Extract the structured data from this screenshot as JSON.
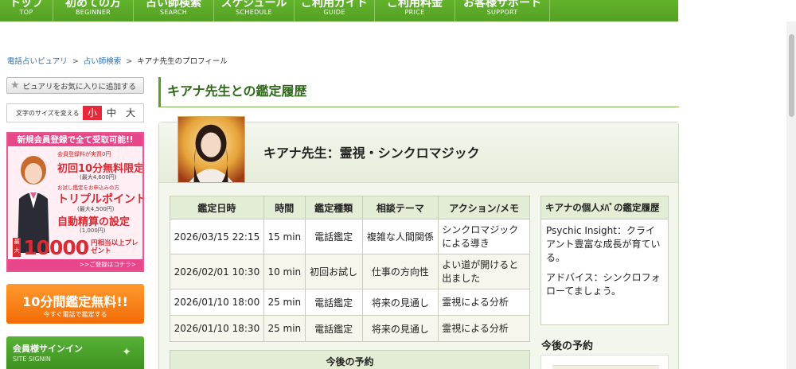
{
  "nav": {
    "items": [
      {
        "jp": "トップ",
        "en": "TOP"
      },
      {
        "jp": "初めての方",
        "en": "BEGINNER"
      },
      {
        "jp": "占い師検索",
        "en": "SEARCH"
      },
      {
        "jp": "スケジュール",
        "en": "SCHEDULE"
      },
      {
        "jp": "ご利用ガイド",
        "en": "GUIDE"
      },
      {
        "jp": "ご利用料金",
        "en": "PRICE"
      },
      {
        "jp": "お客様サポート",
        "en": "SUPPORT"
      }
    ]
  },
  "breadcrumb": {
    "home": "電話占いピュアリ",
    "search": "占い師検索",
    "current": "キアナ先生のプロフィール"
  },
  "sidebar": {
    "favorite_label": "ピュアリをお気に入りに追加する",
    "fontsize": {
      "label": "文字のサイズを変える",
      "small": "小",
      "medium": "中",
      "large": "大"
    },
    "banner_signup": {
      "header": "新規会員登録で全て受取可能!!",
      "line1": "会員登録料が実質0円",
      "line2": "初回10分無料限定",
      "line3": "(最大4,600円)",
      "line4": "お試し鑑定をお申込みの方",
      "line5": "トリプルポイント",
      "line6": "(最大4,500円)",
      "line7": "自動精算の設定",
      "line8": "(1,000円)",
      "tag": "最大",
      "big_number": "10000",
      "big_unit": "円相当以上プレゼント",
      "footer": ">>ご登録はコチラ>"
    },
    "banner_free": {
      "title": "10分間鑑定無料!!",
      "subtitle": "今すぐ電話で鑑定する"
    },
    "signin": {
      "title": "会員様サインイン",
      "subtitle": "SITE SIGNIN"
    }
  },
  "main": {
    "title": "キアナ先生との鑑定履歴",
    "profile_name": "キアナ先生：霊視・シンクロマジック",
    "table": {
      "headers": [
        "鑑定日時",
        "時間",
        "鑑定種類",
        "相談テーマ",
        "アクション/メモ"
      ],
      "rows": [
        {
          "date": "2026/03/15 22:15",
          "duration": "15 min",
          "type": "電話鑑定",
          "theme": "複雑な人間関係",
          "memo": "シンクロマジックによる導き"
        },
        {
          "date": "2026/02/01 10:30",
          "duration": "10 min",
          "type": "初回お試し",
          "theme": "仕事の方向性",
          "memo": "よい道が開けると出ました"
        },
        {
          "date": "2026/01/10 18:00",
          "duration": "25 min",
          "type": "電話鑑定",
          "theme": "将来の見通し",
          "memo": "霊視による分析"
        },
        {
          "date": "2026/01/10 18:30",
          "duration": "25 min",
          "type": "電話鑑定",
          "theme": "将来の見通し",
          "memo": "霊視による分析"
        }
      ]
    },
    "upcoming_label": "今後の予約"
  },
  "side_panel": {
    "title": "キアナの個人ﾒﾊﾞの鑑定履歴",
    "insight": "Psychic Insight：クライアント豊富な成長が育ている。",
    "advice": "アドバイス：シンクロフォローてましょう。",
    "upcoming_title": "今後の予約"
  }
}
